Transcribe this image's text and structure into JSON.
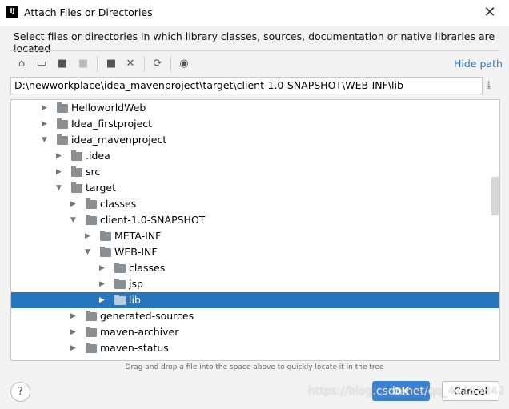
{
  "window": {
    "title": "Attach Files or Directories",
    "close_icon": "close-icon"
  },
  "description": "Select files or directories in which library classes, sources, documentation or native libraries are located",
  "toolbar": {
    "icons": [
      "home-icon",
      "desktop-icon",
      "project-folder-icon",
      "module-folder-icon",
      "new-folder-icon",
      "delete-icon",
      "refresh-icon",
      "show-hidden-icon"
    ],
    "hide_path": "Hide path"
  },
  "path": "D:\\newworkplace\\idea_mavenproject\\target\\client-1.0-SNAPSHOT\\WEB-INF\\lib",
  "tree": [
    {
      "label": "HelloworldWeb",
      "level": 0,
      "expanded": false
    },
    {
      "label": "Idea_firstproject",
      "level": 0,
      "expanded": false
    },
    {
      "label": "idea_mavenproject",
      "level": 0,
      "expanded": true
    },
    {
      "label": ".idea",
      "level": 1,
      "expanded": false
    },
    {
      "label": "src",
      "level": 1,
      "expanded": false
    },
    {
      "label": "target",
      "level": 1,
      "expanded": true
    },
    {
      "label": "classes",
      "level": 2,
      "expanded": false
    },
    {
      "label": "client-1.0-SNAPSHOT",
      "level": 2,
      "expanded": true
    },
    {
      "label": "META-INF",
      "level": 3,
      "expanded": false
    },
    {
      "label": "WEB-INF",
      "level": 3,
      "expanded": true
    },
    {
      "label": "classes",
      "level": 4,
      "expanded": false
    },
    {
      "label": "jsp",
      "level": 4,
      "expanded": false
    },
    {
      "label": "lib",
      "level": 4,
      "expanded": false,
      "selected": true
    },
    {
      "label": "generated-sources",
      "level": 2,
      "expanded": false
    },
    {
      "label": "maven-archiver",
      "level": 2,
      "expanded": false
    },
    {
      "label": "maven-status",
      "level": 2,
      "expanded": false
    }
  ],
  "hint": "Drag and drop a file into the space above to quickly locate it in the tree",
  "buttons": {
    "help": "?",
    "ok": "OK",
    "cancel": "Cancel"
  },
  "watermark": "https://blog.csdn.net/qq_41163342",
  "colors": {
    "accent": "#2675bf",
    "link": "#2a74c9"
  }
}
